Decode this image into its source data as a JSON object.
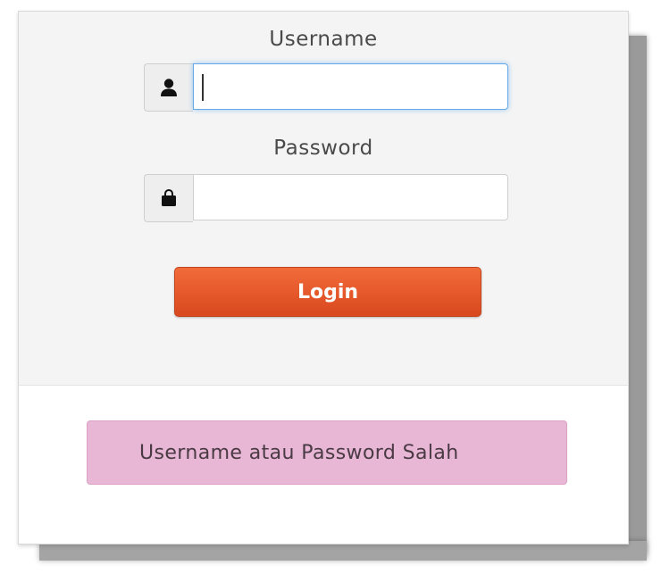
{
  "form": {
    "username_label": "Username",
    "username_value": "",
    "password_label": "Password",
    "password_value": "",
    "login_label": "Login"
  },
  "alert": {
    "message": "Username atau Password Salah"
  },
  "icons": {
    "username_addon": "user-icon",
    "password_addon": "lock-icon"
  },
  "colors": {
    "login_button": "#e4552a",
    "alert_background": "#e8b7d6",
    "focus_border": "#66a8e8"
  }
}
